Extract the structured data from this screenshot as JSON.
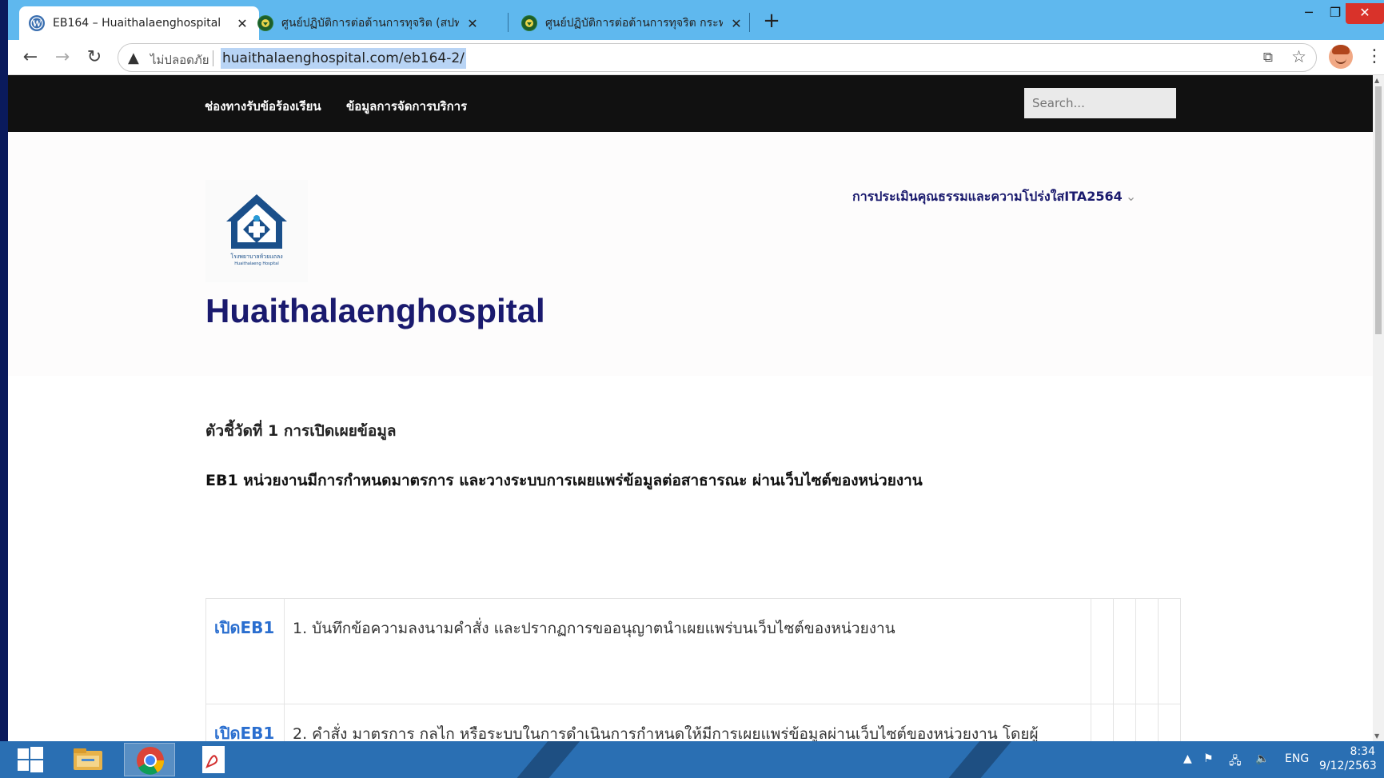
{
  "browser": {
    "tabs": [
      {
        "title": "EB164 – Huaithalaenghospital",
        "active": true
      },
      {
        "title": "ศูนย์ปฏิบัติการต่อต้านการทุจริต (สปท.)",
        "active": false
      },
      {
        "title": "ศูนย์ปฏิบัติการต่อต้านการทุจริต กระทรวง",
        "active": false
      }
    ],
    "new_tab": "+",
    "address": {
      "security_label": "ไม่ปลอดภัย",
      "url": "huaithalaenghospital.com/eb164-2/"
    }
  },
  "site": {
    "nav": {
      "item1": "ช่องทางรับข้อร้องเรียน",
      "item2": "ข้อมูลการจัดการบริการ",
      "search_placeholder": "Search..."
    },
    "logo_text": "โรงพยาบาลห้วยแถลง",
    "logo_sub": "Huaithalaeng Hospital",
    "title": "Huaithalaenghospital",
    "menu_ita": "การประเมินคุณธรรมและความโปร่งใสITA2564",
    "indicator": "ตัวชี้วัดที่ 1 การเปิดเผยข้อมูล",
    "subheading": "EB1 หน่วยงานมีการกำหนดมาตรการ และวางระบบการเผยแพร่ข้อมูลต่อสาธารณะ ผ่านเว็บไซต์ของหน่วยงาน",
    "rows": [
      {
        "link": "เปิดEB1",
        "text": "1. บันทึกข้อความลงนามคำสั่ง และปรากฏการขออนุญาตนำเผยแพร่บนเว็บไซต์ของหน่วยงาน"
      },
      {
        "link": "เปิดEB1",
        "text": "2. คำสั่ง มาตรการ กลไก หรือระบบในการดำเนินการกำหนดให้มีการเผยแพร่ข้อมูลผ่านเว็บไซต์ของหน่วยงาน โดยผู้บริหารสูงสุดของหน่วยงาน"
      }
    ]
  },
  "taskbar": {
    "language": "ENG",
    "time": "8:34",
    "date": "9/12/2563"
  },
  "colors": {
    "tabstrip": "#5fb8ee",
    "site_title": "#1a1a6e",
    "link": "#2a6ecf",
    "taskbar": "#2a6fb3",
    "close": "#d9322a"
  }
}
